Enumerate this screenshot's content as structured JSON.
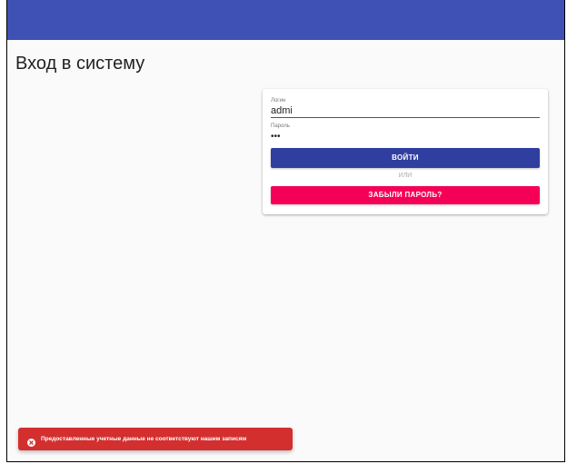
{
  "page": {
    "title": "Вход в систему"
  },
  "colors": {
    "appbar": "#3f51b5",
    "login_button": "#303f9f",
    "forgot_button": "#f50057",
    "toast": "#d32f2f"
  },
  "login_form": {
    "login_label": "Логин",
    "login_value": "admi",
    "password_label": "Пароль",
    "password_value": "•••",
    "login_button_label": "ВОЙТИ",
    "or_text": "ИЛИ",
    "forgot_button_label": "ЗАБЫЛИ ПАРОЛЬ?"
  },
  "toast": {
    "icon": "error-icon",
    "message": "Предоставленные учетные данные не соответствуют нашим записям"
  }
}
